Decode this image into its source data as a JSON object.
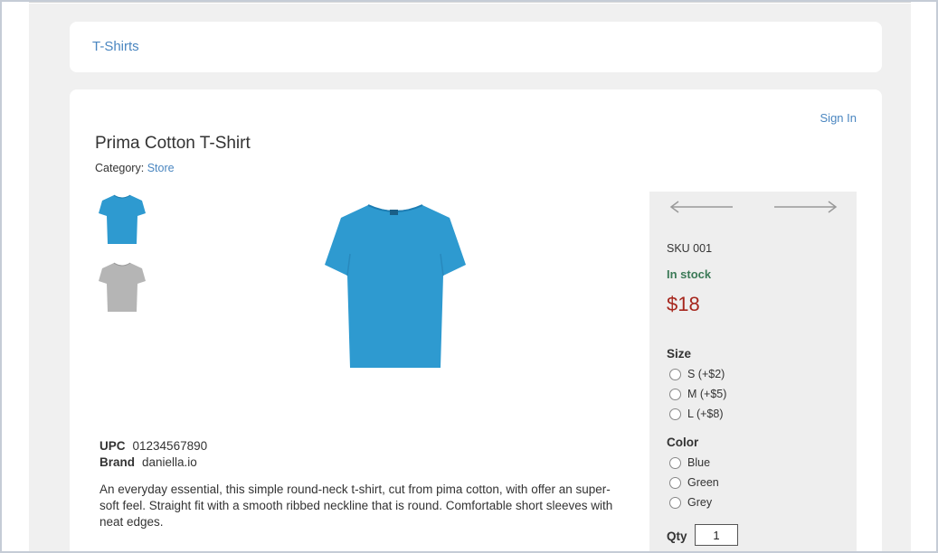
{
  "breadcrumb": {
    "label": "T-Shirts"
  },
  "header": {
    "sign_in": "Sign In"
  },
  "product": {
    "title": "Prima Cotton T-Shirt",
    "category_label": "Category:",
    "category_value": "Store",
    "upc_label": "UPC",
    "upc_value": "01234567890",
    "brand_label": "Brand",
    "brand_value": "daniella.io",
    "description": "An everyday essential, this simple round-neck t-shirt, cut from pima cotton, with offer an super-soft feel. Straight fit with a smooth ribbed neckline that is round. Comfortable short sleeves with neat edges."
  },
  "thumbnails": [
    {
      "name": "blue-tshirt",
      "color": "#2e9ad0"
    },
    {
      "name": "grey-tshirt",
      "color": "#b5b5b5"
    }
  ],
  "main_image": {
    "color": "#2e9ad0"
  },
  "purchase": {
    "sku": "SKU 001",
    "stock": "In stock",
    "price": "$18",
    "size_title": "Size",
    "sizes": [
      "S (+$2)",
      "M (+$5)",
      "L (+$8)"
    ],
    "color_title": "Color",
    "colors": [
      "Blue",
      "Green",
      "Grey"
    ],
    "qty_label": "Qty",
    "qty_value": "1"
  },
  "colors": {
    "link": "#4a86c0",
    "stock": "#3b7a57",
    "price": "#a6261d",
    "panel": "#eeeeee",
    "page_bg": "#f0f0f0"
  }
}
